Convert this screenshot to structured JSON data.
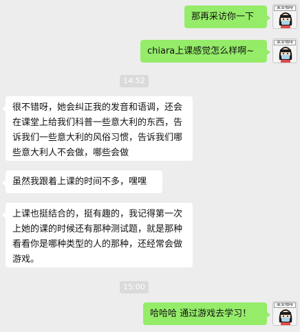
{
  "avatar": {
    "label": "某业咖啡",
    "icon": "girl-with-mask-avatar"
  },
  "messages": [
    {
      "side": "right",
      "text": "那再采访你一下"
    },
    {
      "side": "right",
      "text": "chiara上课感觉怎么样啊~"
    },
    {
      "side": "left",
      "text": "很不错呀，她会纠正我的发音和语调，还会在课堂上给我们科普一些意大利的东西，告诉我们一些意大利的风俗习惯，告诉我们哪些意大利人不会做，哪些会做"
    },
    {
      "side": "left",
      "text": "虽然我跟着上课的时间不多，嘿嘿"
    },
    {
      "side": "left",
      "text": "上课也挺结合的，挺有趣的，我记得第一次上她的课的时候还有那种测试题，就是那种看看你是哪种类型的人的那种，还经常会做游戏。"
    },
    {
      "side": "right",
      "text": "哈哈哈 通过游戏去学习！"
    }
  ],
  "timestamps": [
    "14:52",
    "15:00"
  ],
  "colors": {
    "background": "#ededed",
    "outgoing_bubble": "#95ec69",
    "incoming_bubble": "#ffffff",
    "timestamp_bg": "#dadada"
  }
}
